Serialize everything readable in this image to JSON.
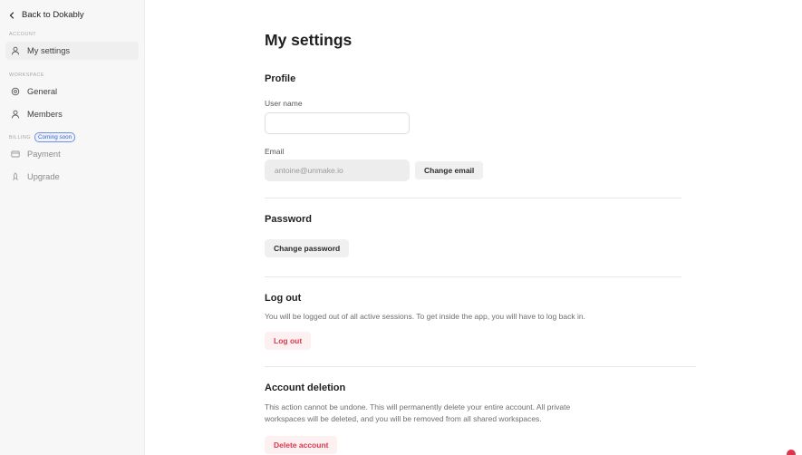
{
  "sidebar": {
    "back_label": "Back to Dokably",
    "sections": {
      "account": "ACCOUNT",
      "workspace": "WORKSPACE",
      "billing": "BILLING"
    },
    "coming_soon": "Coming soon",
    "items": [
      {
        "label": "My settings",
        "icon": "user-icon"
      },
      {
        "label": "General",
        "icon": "gear-icon"
      },
      {
        "label": "Members",
        "icon": "user-icon"
      },
      {
        "label": "Payment",
        "icon": "card-icon"
      },
      {
        "label": "Upgrade",
        "icon": "rocket-icon"
      }
    ]
  },
  "main": {
    "title": "My settings",
    "profile": {
      "heading": "Profile",
      "username_label": "User name",
      "username_value": "",
      "email_label": "Email",
      "email_value": "antoine@unmake.io",
      "change_email": "Change email"
    },
    "password": {
      "heading": "Password",
      "change_password": "Change password"
    },
    "logout": {
      "heading": "Log out",
      "description": "You will be logged out of all active sessions. To get inside the app, you will have to log back in.",
      "button": "Log out"
    },
    "deletion": {
      "heading": "Account deletion",
      "description_line1": "This action cannot be undone. This will permanently delete your entire account. All private",
      "description_line2": "workspaces will be deleted, and you will be removed from all shared workspaces.",
      "button": "Delete account"
    }
  },
  "colors": {
    "accent_blue": "#3c63c9",
    "danger": "#d93a4f",
    "sidebar_bg": "#f7f7f7"
  }
}
